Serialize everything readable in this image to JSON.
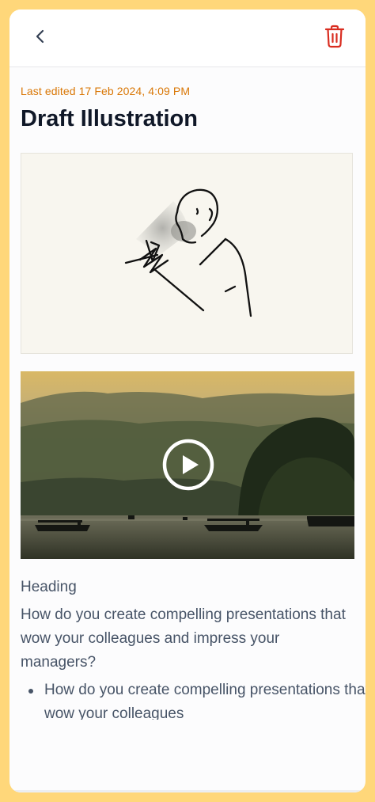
{
  "header": {
    "back_icon": "chevron-left-icon",
    "delete_icon": "trash-icon",
    "accent_color": "#d92d20"
  },
  "note": {
    "last_edited": "Last edited 17 Feb 2024, 4:09 PM",
    "title": "Draft Illustration",
    "heading": "Heading",
    "paragraph": "How do you create compelling presentations that wow your colleagues and impress your managers?",
    "bullets": [
      "How do you create compelling presentations that wow your colleagues"
    ]
  },
  "media": {
    "video_icon": "play-icon"
  },
  "colors": {
    "meta": "#d97706",
    "title": "#101828",
    "body": "#475467",
    "frame": "#ffd77a"
  }
}
